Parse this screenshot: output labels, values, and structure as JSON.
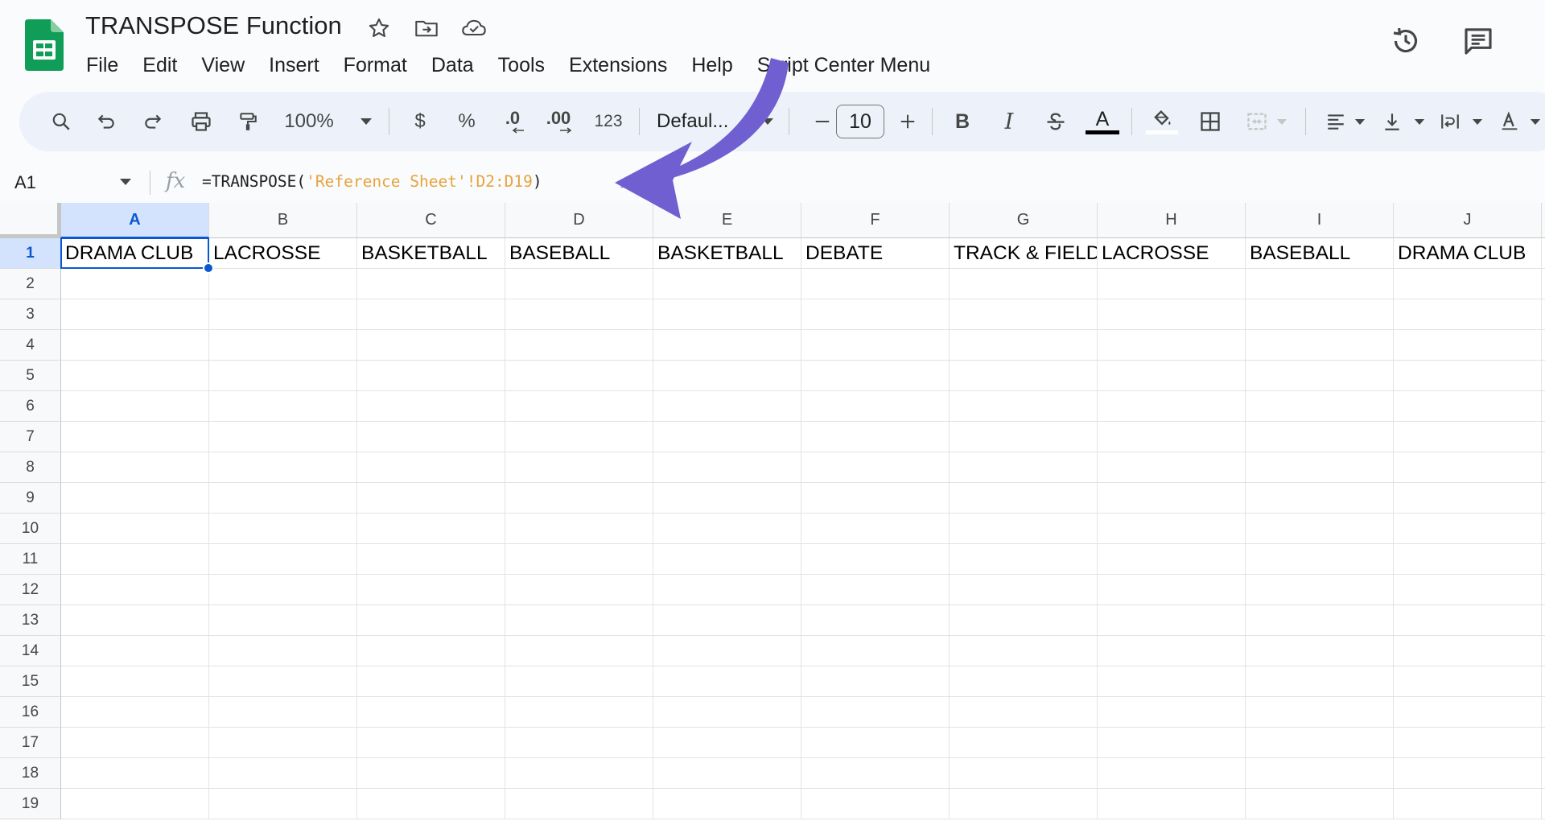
{
  "app": {
    "title": "TRANSPOSE Function"
  },
  "menu": [
    "File",
    "Edit",
    "View",
    "Insert",
    "Format",
    "Data",
    "Tools",
    "Extensions",
    "Help",
    "Script Center Menu"
  ],
  "toolbar": {
    "zoom": "100%",
    "currency_label": "$",
    "percent_label": "%",
    "decrease_decimal_label": ".0",
    "increase_decimal_label": ".00",
    "number_format_label": "123",
    "font_name": "Defaul...",
    "font_size": "10",
    "bold_label": "B",
    "italic_label": "I",
    "text_color_label": "A"
  },
  "formula_bar": {
    "cell_ref": "A1",
    "formula_prefix": "=TRANSPOSE(",
    "formula_ref": "'Reference Sheet'!D2:D19",
    "formula_suffix": ")"
  },
  "grid": {
    "columns": [
      "A",
      "B",
      "C",
      "D",
      "E",
      "F",
      "G",
      "H",
      "I",
      "J"
    ],
    "rows": [
      "1",
      "2",
      "3",
      "4",
      "5",
      "6",
      "7",
      "8",
      "9",
      "10",
      "11",
      "12",
      "13",
      "14",
      "15",
      "16",
      "17",
      "18",
      "19"
    ],
    "selected_cell": "A1",
    "row1_values": [
      "DRAMA CLUB",
      "LACROSSE",
      "BASKETBALL",
      "BASEBALL",
      "BASKETBALL",
      "DEBATE",
      "TRACK & FIELD",
      "LACROSSE",
      "BASEBALL",
      "DRAMA CLUB"
    ]
  },
  "colors": {
    "accent": "#0b57d0",
    "selection_header": "#d3e3fd",
    "toolbar_bg": "#edf2fa",
    "annotation_arrow": "#6f5fd0",
    "sheets_green": "#0f9d58",
    "formula_ref": "#e8a33c"
  },
  "icons": {
    "logo": "google-sheets-logo",
    "title_icons": [
      "star-icon",
      "move-to-folder-icon",
      "cloud-saved-icon"
    ],
    "right_icons": [
      "version-history-icon",
      "comments-icon"
    ]
  }
}
